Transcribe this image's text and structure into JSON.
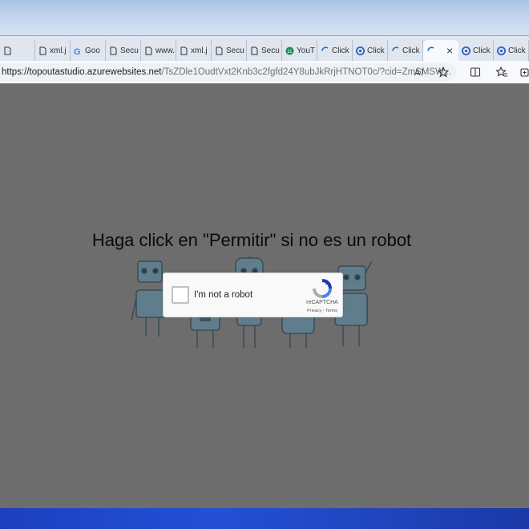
{
  "browser": {
    "tabs": [
      {
        "label": "",
        "icon": "page-icon"
      },
      {
        "label": "xml.j",
        "icon": "page-icon"
      },
      {
        "label": "Goo",
        "icon": "google-icon"
      },
      {
        "label": "Secu",
        "icon": "page-icon"
      },
      {
        "label": "www.",
        "icon": "page-icon"
      },
      {
        "label": "xml.j",
        "icon": "page-icon"
      },
      {
        "label": "Secu",
        "icon": "page-icon"
      },
      {
        "label": "Secu",
        "icon": "page-icon"
      },
      {
        "label": "YouT",
        "icon": "youtube-icon"
      },
      {
        "label": "Click",
        "icon": "loading-icon"
      },
      {
        "label": "Click",
        "icon": "edge-icon"
      },
      {
        "label": "Click",
        "icon": "loading-icon"
      },
      {
        "label": "",
        "icon": "loading-icon",
        "active": true,
        "close": "×"
      },
      {
        "label": "Click",
        "icon": "edge-icon"
      },
      {
        "label": "Click",
        "icon": "edge-icon"
      }
    ],
    "new_tab": "+",
    "address": {
      "host": "https://topoutastudio.azurewebsites.net",
      "path": "/TsZDle1OudtVxt2Knb3c2fgfd24Y8ubJkRrjHTNOT0c/?cid=ZmSMSW..."
    }
  },
  "page": {
    "headline": "Haga click en \"Permitir\" si no es un robot",
    "captcha": {
      "checkbox_label": "I'm not a robot",
      "brand": "reCAPTCHA",
      "links": "Privacy - Terms"
    }
  },
  "colors": {
    "page_bg": "#6d6d6d",
    "tabbar_bg": "#dfe6ef",
    "taskbar": "#2450d6"
  }
}
